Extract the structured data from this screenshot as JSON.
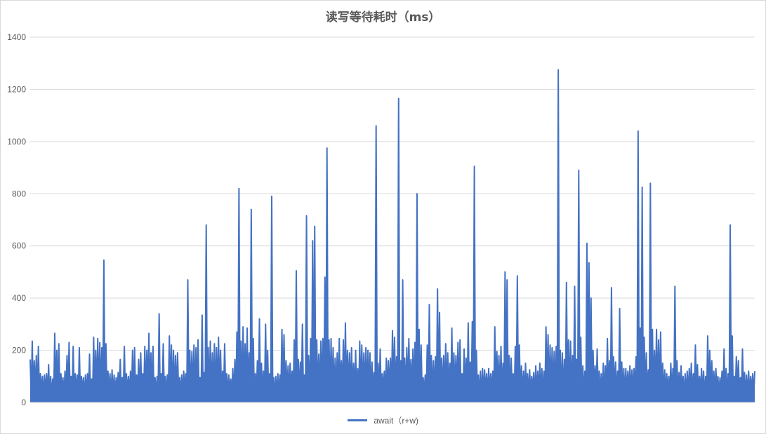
{
  "chart_data": {
    "type": "line",
    "title": "读写等待耗时（ms）",
    "xlabel": "",
    "ylabel": "",
    "ylim": [
      0,
      1400
    ],
    "y_ticks": [
      "0",
      "200",
      "400",
      "600",
      "800",
      "1000",
      "1200",
      "1400"
    ],
    "grid": true,
    "legend_position": "bottom",
    "color": "#4472c4",
    "series": [
      {
        "name": "await（r+w)",
        "values": [
          165,
          235,
          160,
          180,
          215,
          110,
          100,
          105,
          110,
          145,
          100,
          90,
          265,
          200,
          225,
          110,
          95,
          120,
          180,
          230,
          100,
          215,
          110,
          105,
          210,
          100,
          95,
          105,
          110,
          185,
          90,
          250,
          200,
          245,
          230,
          210,
          545,
          225,
          120,
          110,
          125,
          105,
          95,
          115,
          165,
          95,
          215,
          110,
          100,
          120,
          200,
          210,
          105,
          165,
          190,
          110,
          215,
          200,
          265,
          190,
          215,
          95,
          100,
          340,
          110,
          225,
          100,
          105,
          255,
          220,
          200,
          180,
          190,
          95,
          105,
          120,
          110,
          470,
          200,
          195,
          220,
          210,
          240,
          95,
          335,
          115,
          680,
          210,
          235,
          190,
          225,
          210,
          250,
          200,
          120,
          225,
          110,
          105,
          90,
          130,
          165,
          270,
          820,
          235,
          290,
          225,
          285,
          190,
          740,
          245,
          110,
          160,
          320,
          150,
          120,
          300,
          200,
          110,
          790,
          95,
          100,
          110,
          105,
          280,
          260,
          160,
          140,
          150,
          120,
          240,
          505,
          165,
          155,
          300,
          105,
          715,
          180,
          245,
          620,
          675,
          240,
          185,
          235,
          245,
          480,
          975,
          240,
          245,
          210,
          170,
          190,
          245,
          160,
          240,
          305,
          200,
          190,
          210,
          150,
          200,
          130,
          235,
          220,
          190,
          210,
          200,
          190,
          155,
          115,
          1060,
          150,
          205,
          110,
          120,
          170,
          160,
          170,
          275,
          250,
          175,
          1165,
          160,
          470,
          170,
          210,
          245,
          165,
          205,
          230,
          800,
          280,
          220,
          95,
          105,
          220,
          375,
          180,
          160,
          175,
          435,
          345,
          170,
          180,
          225,
          190,
          150,
          285,
          190,
          180,
          230,
          240,
          110,
          205,
          170,
          305,
          155,
          310,
          905,
          200,
          105,
          120,
          130,
          125,
          110,
          130,
          110,
          120,
          290,
          195,
          180,
          215,
          150,
          500,
          470,
          180,
          170,
          110,
          215,
          485,
          220,
          140,
          120,
          150,
          110,
          125,
          100,
          115,
          140,
          120,
          150,
          130,
          120,
          290,
          260,
          220,
          210,
          195,
          215,
          1275,
          200,
          190,
          165,
          460,
          240,
          235,
          180,
          445,
          165,
          890,
          250,
          140,
          120,
          610,
          535,
          400,
          200,
          140,
          205,
          120,
          110,
          150,
          140,
          245,
          160,
          440,
          175,
          155,
          120,
          360,
          155,
          130,
          130,
          120,
          140,
          125,
          130,
          175,
          1040,
          285,
          825,
          250,
          190,
          125,
          840,
          280,
          200,
          280,
          240,
          270,
          150,
          125,
          110,
          100,
          150,
          130,
          445,
          160,
          115,
          140,
          100,
          110,
          120,
          130,
          150,
          110,
          220,
          145,
          100,
          130,
          120,
          100,
          255,
          200,
          160,
          120,
          130,
          100,
          95,
          120,
          205,
          130,
          110,
          680,
          255,
          100,
          175,
          160,
          95,
          205,
          115,
          105,
          120,
          100,
          110,
          120
        ]
      }
    ]
  }
}
